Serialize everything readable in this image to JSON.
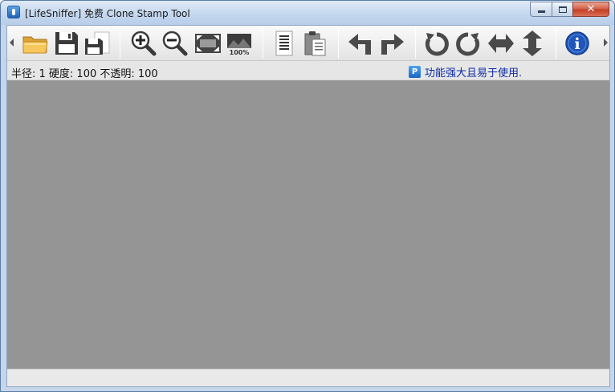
{
  "window": {
    "title": "[LifeSniffer]  免费 Clone Stamp Tool",
    "close_glyph": "✕"
  },
  "toolbar": {
    "buttons": [
      {
        "name": "open-folder-button",
        "icon": "folder-icon"
      },
      {
        "name": "save-button",
        "icon": "floppy-disk-icon"
      },
      {
        "name": "save-as-button",
        "icon": "floppy-disk-small-icon"
      },
      {
        "name": "zoom-in-button",
        "icon": "zoom-in-icon"
      },
      {
        "name": "zoom-out-button",
        "icon": "zoom-out-icon"
      },
      {
        "name": "fit-to-window-button",
        "icon": "fit-window-icon"
      },
      {
        "name": "actual-size-button",
        "icon": "actual-size-icon",
        "label": "100%"
      },
      {
        "name": "copy-button",
        "icon": "document-icon"
      },
      {
        "name": "paste-button",
        "icon": "clipboard-icon"
      },
      {
        "name": "undo-button",
        "icon": "arrow-turn-left-icon"
      },
      {
        "name": "redo-button",
        "icon": "arrow-turn-right-icon"
      },
      {
        "name": "rotate-left-button",
        "icon": "rotate-ccw-icon"
      },
      {
        "name": "rotate-right-button",
        "icon": "rotate-cw-icon"
      },
      {
        "name": "flip-horizontal-button",
        "icon": "flip-horizontal-icon"
      },
      {
        "name": "flip-vertical-button",
        "icon": "flip-vertical-icon"
      },
      {
        "name": "about-button",
        "icon": "info-icon",
        "label": "i"
      }
    ]
  },
  "status": {
    "params_text": "半径: 1 硬度: 100 不透明: 100",
    "promo_icon_letter": "P",
    "promo_text": "功能强大且易于使用."
  },
  "colors": {
    "canvas_background": "#959595",
    "link": "#0c2aa8",
    "info_blue": "#1f56b8",
    "icon_gray": "#4a4a4a"
  }
}
